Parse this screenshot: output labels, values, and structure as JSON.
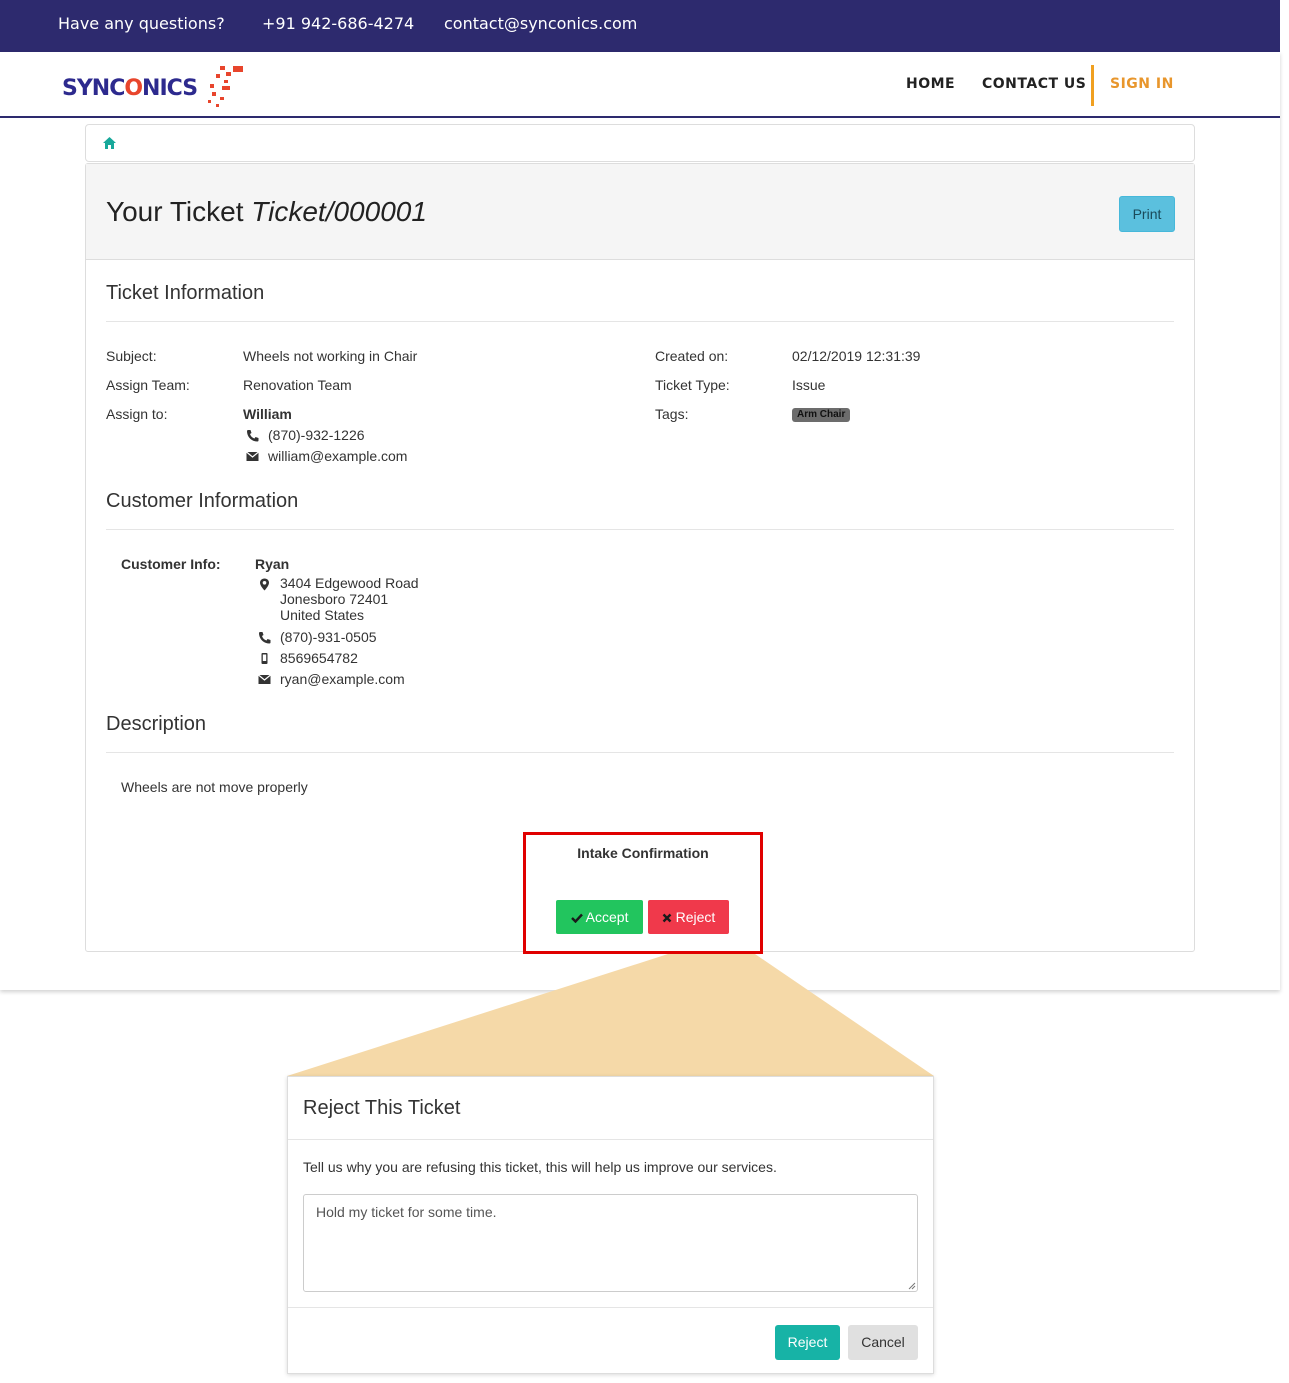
{
  "topbar": {
    "question": "Have any questions?",
    "phone": "+91 942-686-4274",
    "email": "contact@synconics.com"
  },
  "brand": {
    "logo_prefix": "SYNC",
    "logo_o": "O",
    "logo_suffix": "NICS",
    "primary_color": "#2d2a6e",
    "accent_color": "#e8452c"
  },
  "nav": {
    "home": "HOME",
    "contact": "CONTACT US",
    "signin": "SIGN IN"
  },
  "breadcrumb": {
    "icon": "home-icon"
  },
  "ticket": {
    "title_prefix": "Your Ticket",
    "ticket_ref": "Ticket/000001",
    "print_label": "Print"
  },
  "ticket_info": {
    "heading": "Ticket Information",
    "subject_label": "Subject:",
    "subject_value": "Wheels not working in Chair",
    "team_label": "Assign Team:",
    "team_value": "Renovation Team",
    "assign_label": "Assign to:",
    "assign_name": "William",
    "assign_phone": "(870)-932-1226",
    "assign_email": "william@example.com",
    "created_label": "Created on:",
    "created_value": "02/12/2019 12:31:39",
    "type_label": "Ticket Type:",
    "type_value": "Issue",
    "tags_label": "Tags:",
    "tag": "Arm Chair"
  },
  "customer_info": {
    "heading": "Customer Information",
    "label": "Customer Info:",
    "name": "Ryan",
    "address_line1": "3404 Edgewood Road",
    "address_line2": "Jonesboro 72401",
    "address_line3": "United States",
    "phone": "(870)-931-0505",
    "mobile": "8569654782",
    "email": "ryan@example.com"
  },
  "description": {
    "heading": "Description",
    "text": "Wheels are not move properly"
  },
  "intake": {
    "title": "Intake Confirmation",
    "accept_label": "Accept",
    "reject_label": "Reject",
    "highlight_color": "#e00000"
  },
  "modal": {
    "title": "Reject This Ticket",
    "prompt": "Tell us why you are refusing this ticket, this will help us improve our services.",
    "textarea_value": "Hold my ticket for some time.",
    "reject_label": "Reject",
    "cancel_label": "Cancel",
    "callout_color": "#f5d9a8"
  }
}
